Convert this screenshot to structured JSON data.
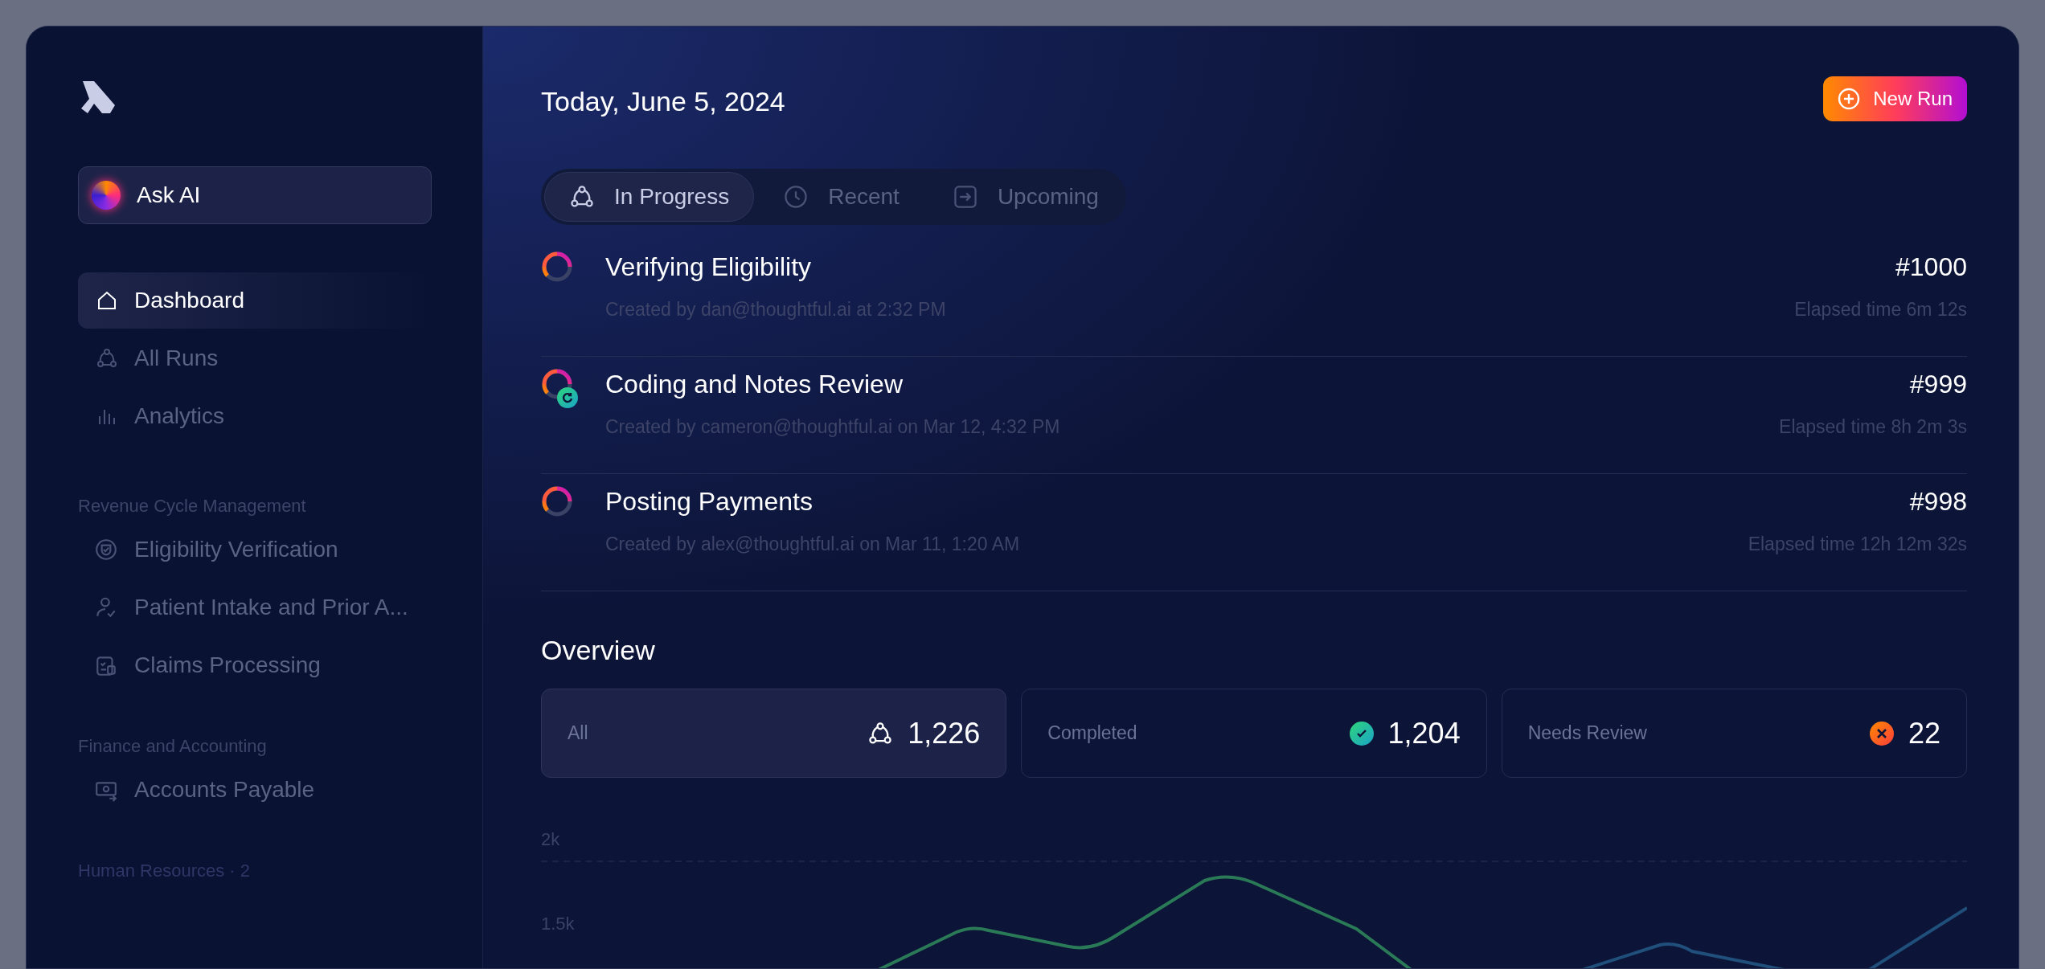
{
  "sidebar": {
    "ask_ai": {
      "label": "Ask AI"
    },
    "nav": [
      {
        "label": "Dashboard",
        "selected": true
      },
      {
        "label": "All Runs",
        "selected": false
      },
      {
        "label": "Analytics",
        "selected": false
      }
    ],
    "sections": [
      {
        "title": "Revenue Cycle Management",
        "items": [
          {
            "label": "Eligibility Verification"
          },
          {
            "label": "Patient Intake and Prior A..."
          },
          {
            "label": "Claims Processing"
          }
        ]
      },
      {
        "title": "Finance and Accounting",
        "items": [
          {
            "label": "Accounts Payable"
          }
        ]
      },
      {
        "title": "Human Resources · 2"
      }
    ]
  },
  "header": {
    "date": "Today, June 5, 2024",
    "new_run": "New Run"
  },
  "tabs": [
    {
      "label": "In Progress",
      "selected": true
    },
    {
      "label": "Recent",
      "selected": false
    },
    {
      "label": "Upcoming",
      "selected": false
    }
  ],
  "runs": [
    {
      "title": "Verifying Eligibility",
      "created": "Created by dan@thoughtful.ai at 2:32 PM",
      "number": "#1000",
      "elapsed": "Elapsed time 6m 12s",
      "retry": false
    },
    {
      "title": "Coding and Notes Review",
      "created": "Created by cameron@thoughtful.ai on Mar 12, 4:32 PM",
      "number": "#999",
      "elapsed": "Elapsed time 8h 2m 3s",
      "retry": true
    },
    {
      "title": "Posting Payments",
      "created": "Created by alex@thoughtful.ai on Mar 11, 1:20 AM",
      "number": "#998",
      "elapsed": "Elapsed time 12h 12m 32s",
      "retry": false
    }
  ],
  "overview": {
    "title": "Overview",
    "cards": [
      {
        "label": "All",
        "value": "1,226",
        "kind": "all",
        "selected": true
      },
      {
        "label": "Completed",
        "value": "1,204",
        "kind": "completed",
        "selected": false
      },
      {
        "label": "Needs Review",
        "value": "22",
        "kind": "review",
        "selected": false
      }
    ],
    "chart": {
      "y_tick_labels": [
        "2k",
        "1.5k"
      ]
    }
  }
}
